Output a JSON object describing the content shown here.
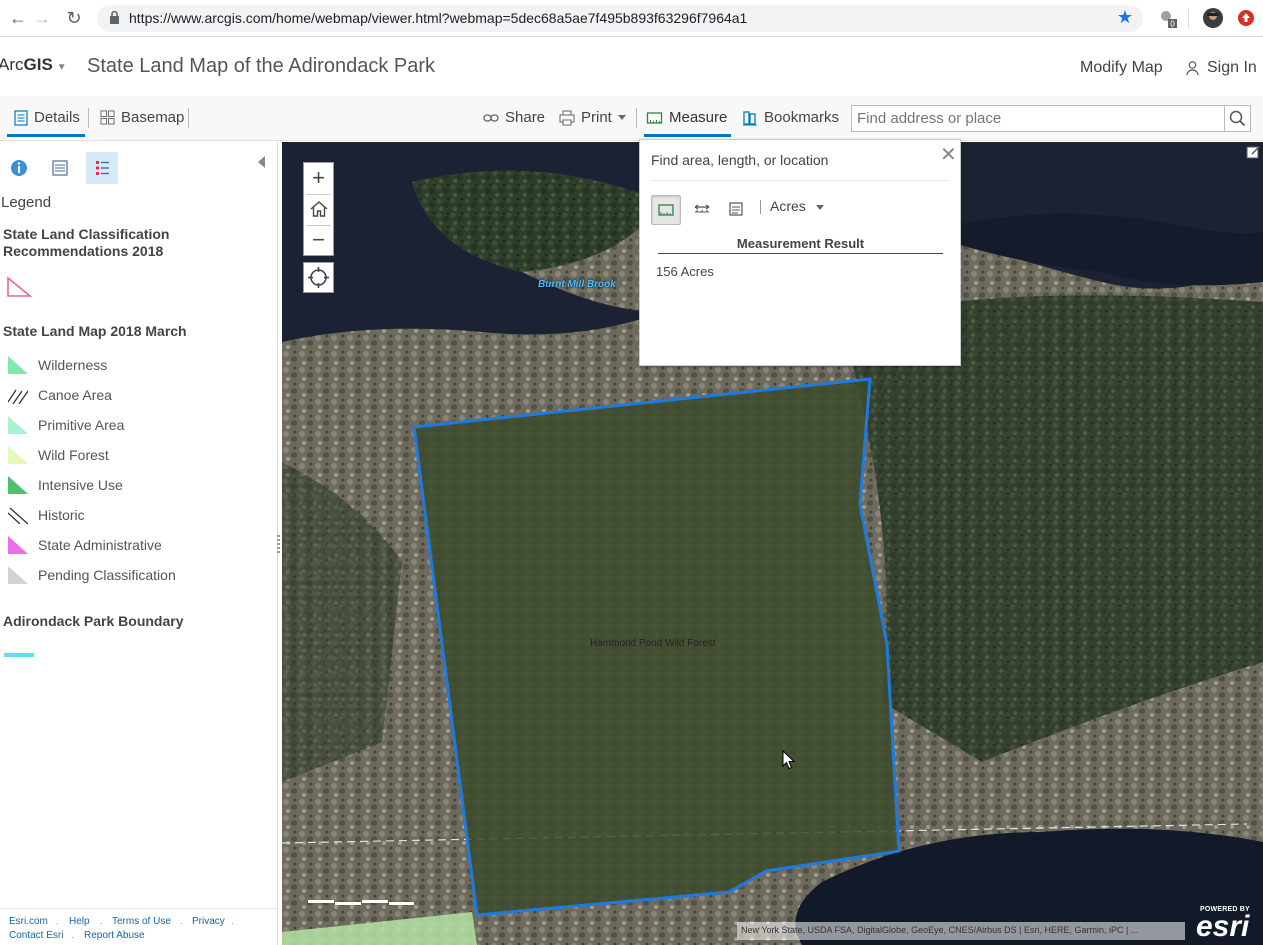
{
  "browser": {
    "url": "https://www.arcgis.com/home/webmap/viewer.html?webmap=5dec68a5ae7f495b893f63296f7964a1",
    "ext_badge": "0"
  },
  "header": {
    "brand_prefix": "Arc",
    "brand_bold": "GIS",
    "map_title": "State Land Map of the Adirondack Park",
    "modify_map": "Modify Map",
    "sign_in": "Sign In"
  },
  "toolbar": {
    "details": "Details",
    "basemap": "Basemap",
    "share": "Share",
    "print": "Print",
    "measure": "Measure",
    "bookmarks": "Bookmarks",
    "search_placeholder": "Find address or place"
  },
  "sidebar": {
    "legend_title": "Legend",
    "layers": [
      {
        "title": "State Land Classification Recommendations 2018"
      },
      {
        "title": "State Land Map 2018 March"
      },
      {
        "title": "Adirondack Park Boundary"
      }
    ],
    "legend_items": [
      {
        "label": "Wilderness",
        "color": "#7ee8b0"
      },
      {
        "label": "Canoe Area",
        "color": "hatch"
      },
      {
        "label": "Primitive Area",
        "color": "#a8f2d0"
      },
      {
        "label": "Wild Forest",
        "color": "#e4f8b8"
      },
      {
        "label": "Intensive Use",
        "color": "#4fbf70"
      },
      {
        "label": "Historic",
        "color": "hatch"
      },
      {
        "label": "State Administrative",
        "color": "#f06bea"
      },
      {
        "label": "Pending Classification",
        "color": "#d3d3d3"
      }
    ],
    "footer": {
      "esri": "Esri.com",
      "help": "Help",
      "terms": "Terms of Use",
      "privacy": "Privacy",
      "contact": "Contact Esri",
      "report": "Report Abuse"
    }
  },
  "measure_panel": {
    "prompt": "Find area, length, or location",
    "unit": "Acres",
    "result_title": "Measurement Result",
    "result": "156 Acres"
  },
  "map": {
    "labels": {
      "brook": "Burnt Mill Brook",
      "parcel": "Hammond Pond Wild Forest"
    },
    "attribution": "New York State, USDA FSA, DigitalGlobe, GeoEye, CNES/Airbus DS | Esri, HERE, Garmin, iPC | ...",
    "esri_powered": "POWERED BY",
    "esri_word": "esri",
    "accent_color": "#1f7ae0"
  }
}
